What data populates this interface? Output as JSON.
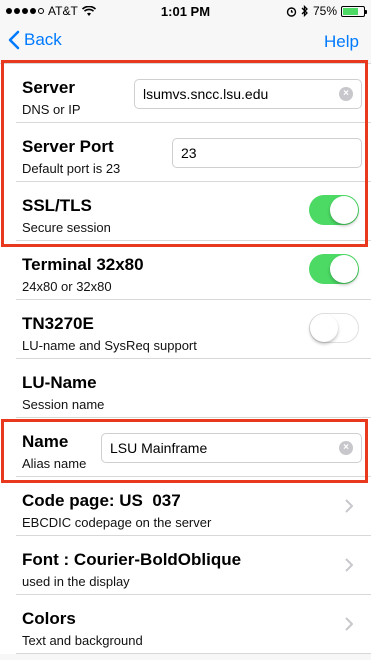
{
  "status_bar": {
    "carrier": "AT&T",
    "time": "1:01 PM",
    "battery_percent": "75%",
    "battery_level": 0.75,
    "signal_bars": 4
  },
  "nav": {
    "back_label": "Back",
    "help_label": "Help"
  },
  "rows": [
    {
      "title": "Server",
      "subtitle": "DNS or IP",
      "control": "textfield",
      "value": "lsumvs.sncc.lsu.edu"
    },
    {
      "title": "Server Port",
      "subtitle": "Default port is 23",
      "control": "textfield",
      "value": "23"
    },
    {
      "title": "SSL/TLS",
      "subtitle": "Secure session",
      "control": "toggle",
      "on": true
    },
    {
      "title": "Terminal 32x80",
      "subtitle": "24x80 or 32x80",
      "control": "toggle",
      "on": true
    },
    {
      "title": "TN3270E",
      "subtitle": "LU-name and SysReq support",
      "control": "toggle",
      "on": false
    },
    {
      "title": "LU-Name",
      "subtitle": "Session name",
      "control": "none"
    },
    {
      "title": "Name",
      "subtitle": "Alias name",
      "control": "textfield",
      "value": "LSU Mainframe"
    },
    {
      "title": "Code page: US  037",
      "subtitle": "EBCDIC codepage on the server",
      "control": "chevron"
    },
    {
      "title": "Font : Courier-BoldOblique",
      "subtitle": "used in the display",
      "control": "chevron"
    },
    {
      "title": "Colors",
      "subtitle": "Text and background",
      "control": "chevron"
    }
  ],
  "colors": {
    "accent": "#007aff",
    "toggle_on": "#4cd964",
    "highlight": "#e8391f"
  }
}
